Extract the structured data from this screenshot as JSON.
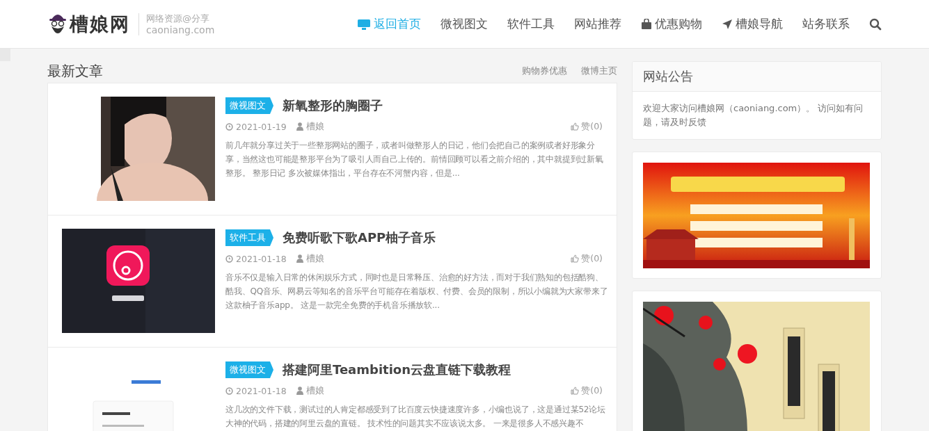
{
  "header": {
    "logo_text": "槽娘网",
    "tagline": "网络资源@分享",
    "domain": "caoniang.com",
    "nav": [
      {
        "label": "返回首页",
        "selected": true
      },
      {
        "label": "微视图文",
        "selected": false
      },
      {
        "label": "软件工具",
        "selected": false
      },
      {
        "label": "网站推荐",
        "selected": false
      },
      {
        "label": "优惠购物",
        "selected": false
      },
      {
        "label": "槽娘导航",
        "selected": false
      },
      {
        "label": "站务联系",
        "selected": false
      }
    ]
  },
  "section": {
    "title": "最新文章",
    "links": [
      "购物券优惠",
      "微博主页"
    ]
  },
  "articles": [
    {
      "category": "微视图文",
      "title": "新氧整形的胸圈子",
      "date": "2021-01-19",
      "author": "槽娘",
      "likes": "赞(0)",
      "excerpt": "前几年就分享过关于一些整形网站的圈子，或者叫做整形人的日记，他们会把自己的案例或者好形象分享，当然这也可能是整形平台为了吸引人而自己上传的。前情回顾可以看之前介绍的，其中就提到过新氧整形。 整形日记 多次被媒体指出，平台存在不河蟹内容，但是..."
    },
    {
      "category": "软件工具",
      "title": "免费听歌下歌APP柚子音乐",
      "date": "2021-01-18",
      "author": "槽娘",
      "likes": "赞(0)",
      "excerpt": "音乐不仅是输入日常的休闲娱乐方式，同时也是日常释压、治愈的好方法，而对于我们熟知的包括酷狗、酷我、QQ音乐、网易云等知名的音乐平台可能存在着版权、付费、会员的限制，所以小编就为大家带来了这款柚子音乐app。 这是一款完全免费的手机音乐播放软..."
    },
    {
      "category": "微视图文",
      "title": "搭建阿里Teambition云盘直链下载教程",
      "date": "2021-01-18",
      "author": "槽娘",
      "likes": "赞(0)",
      "excerpt": "这几次的文件下载，测试过的人肯定都感受到了比百度云快捷速度许多，小编也说了，这是通过某52论坛大神的代码，搭建的阿里云盘的直链。 技术性的问题其实不应该说太多。 一来是很多人不感兴趣不"
    }
  ],
  "sidebar": {
    "notice": {
      "title": "网站公告",
      "text": "欢迎大家访问槽娘网（caoniang.com）。 访问如有问题，请及时反馈"
    }
  }
}
